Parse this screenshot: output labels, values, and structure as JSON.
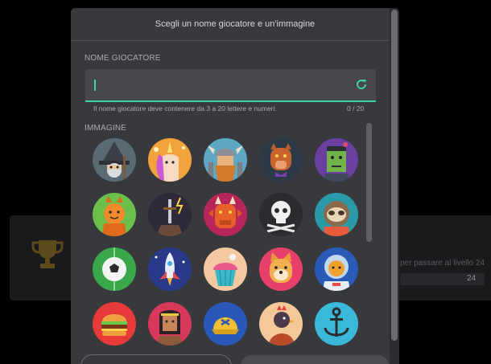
{
  "background": {
    "progress_text": "per passare al livello 24",
    "progress_value": "24"
  },
  "dialog": {
    "title": "Scegli un nome giocatore e un'immagine",
    "name_label": "NOME GIOCATORE",
    "name_value": "",
    "hint": "Il nome giocatore deve contenere da 3 a 20 lettere e numeri.",
    "counter": "0 / 20",
    "image_label": "IMMAGINE",
    "avatars": [
      "wizard-avatar",
      "unicorn-avatar",
      "viking-avatar",
      "werewolf-avatar",
      "frankenstein-avatar",
      "pumpkin-cat-avatar",
      "sword-avatar",
      "dragon-avatar",
      "skull-avatar",
      "sloth-avatar",
      "soccer-ball-avatar",
      "rocket-avatar",
      "cupcake-avatar",
      "doge-avatar",
      "astronaut-cat-avatar",
      "burger-avatar",
      "native-warrior-avatar",
      "cap-avatar",
      "chicken-avatar",
      "anchor-avatar"
    ]
  },
  "colors": {
    "accent": "#3fd0a3",
    "dialog_bg": "#37393d",
    "field_bg": "#45474c"
  }
}
